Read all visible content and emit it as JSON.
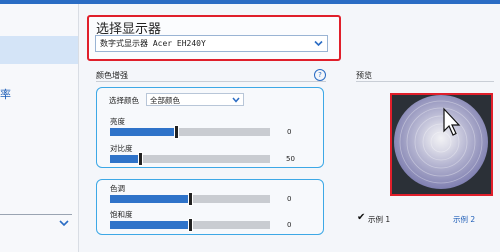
{
  "left_panel": {
    "partial_text": "率"
  },
  "monitor": {
    "title": "选择显示器",
    "selected": "数字式显示器 Acer EH240Y"
  },
  "color_enhance": {
    "section_title": "颜色增强",
    "help": "?",
    "select_label": "选择颜色",
    "select_value": "全部颜色",
    "sliders": [
      {
        "label": "亮度",
        "value": "0",
        "level": 0.41
      },
      {
        "label": "对比度",
        "value": "50",
        "level": 0.19
      },
      {
        "label": "色调",
        "value": "0",
        "level": 0.5
      },
      {
        "label": "饱和度",
        "value": "0",
        "level": 0.5
      }
    ]
  },
  "preview": {
    "label": "预览",
    "sample1": "示例 1",
    "sample2": "示例 2"
  },
  "colors": {
    "accent": "#2f73c9",
    "highlight": "#e01f2b",
    "group_border": "#3da8e6"
  },
  "icons": [
    "chevron-down-icon",
    "help-icon",
    "check-icon",
    "cursor-icon"
  ]
}
